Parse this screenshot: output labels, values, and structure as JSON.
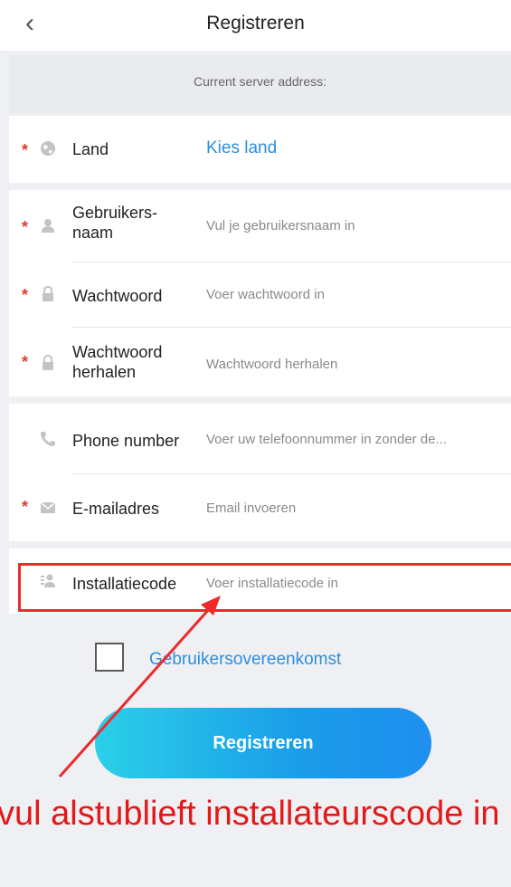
{
  "header": {
    "back_icon": "‹",
    "title": "Registreren"
  },
  "server": {
    "label": "Current server address:"
  },
  "fields": {
    "land": {
      "label": "Land",
      "value": "Kies land",
      "icon": "globe-icon"
    },
    "username": {
      "label_line1": "Gebruikers-",
      "label_line2": "naam",
      "placeholder": "Vul je gebruikersnaam in",
      "icon": "user-icon"
    },
    "password": {
      "label": "Wachtwoord",
      "placeholder": "Voer wachtwoord in",
      "icon": "lock-icon"
    },
    "password_repeat": {
      "label_line1": "Wachtwoord",
      "label_line2": "herhalen",
      "placeholder": "Wachtwoord herhalen",
      "icon": "lock-icon"
    },
    "phone": {
      "label": "Phone number",
      "placeholder": "Voer uw telefoonnummer in zonder de...",
      "icon": "phone-icon"
    },
    "email": {
      "label": "E-mailadres",
      "placeholder": "Email invoeren",
      "icon": "mail-icon"
    },
    "install_code": {
      "label": "Installatiecode",
      "placeholder": "Voer installatiecode in",
      "icon": "id-card-icon"
    }
  },
  "required_mark": "*",
  "agreement": {
    "label": "Gebruikersovereenkomst",
    "checked": false
  },
  "register_button": "Registreren",
  "annotation": {
    "text": "vul alstublieft installateurscode in"
  },
  "colors": {
    "accent": "#2e8ee0",
    "required": "#e23b2c",
    "highlight": "#ee2a2a",
    "button_start": "#2bd0e8",
    "button_end": "#1f8ff0"
  }
}
